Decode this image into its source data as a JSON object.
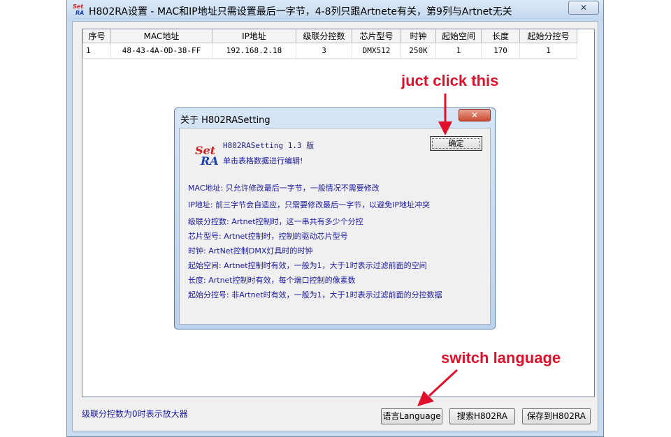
{
  "window": {
    "title": "H802RA设置 - MAC和IP地址只需设置最后一字节，4-8列只跟Artnete有关，第9列与Artnet无关",
    "icon_text_top": "Set",
    "icon_text_bottom": "RA",
    "close_label": "✕"
  },
  "table": {
    "columns": [
      "序号",
      "MAC地址",
      "IP地址",
      "级联分控数",
      "芯片型号",
      "时钟",
      "起始空间",
      "长度",
      "起始分控号"
    ],
    "rows": [
      [
        "1",
        "48-43-4A-0D-38-FF",
        "192.168.2.18",
        "3",
        "DMX512",
        "250K",
        "1",
        "170",
        "1"
      ]
    ]
  },
  "status": {
    "text": "级联分控数为0时表示放大器"
  },
  "buttons": {
    "language": "语言Language",
    "search": "搜索H802RA",
    "save": "保存到H802RA"
  },
  "dialog": {
    "title": "关于 H802RASetting",
    "close_label": "✕",
    "logo_top": "Set",
    "logo_bottom": "RA",
    "version": "H802RASetting 1.3 版",
    "hint": "单击表格数据进行编辑!",
    "ok_label": "确定",
    "lines": [
      "MAC地址: 只允许修改最后一字节，一般情况不需要修改",
      "IP地址: 前三字节会自适应，只需要修改最后一字节，以避免IP地址冲突",
      "级联分控数: Artnet控制时，这一串共有多少个分控",
      "芯片型号: Artnet控制时，控制的驱动芯片型号",
      "时钟: ArtNet控制DMX灯具时的时钟",
      "起始空间: Artnet控制时有效，一般为1，大于1时表示过滤前面的空间",
      "长度: Artnet控制时有效，每个端口控制的像素数",
      "起始分控号: 非Artnet时有效，一般为1，大于1时表示过滤前面的分控数据"
    ]
  },
  "annotations": {
    "click_this": "juct click this",
    "switch_language": "switch language",
    "color": "#e0102a"
  }
}
